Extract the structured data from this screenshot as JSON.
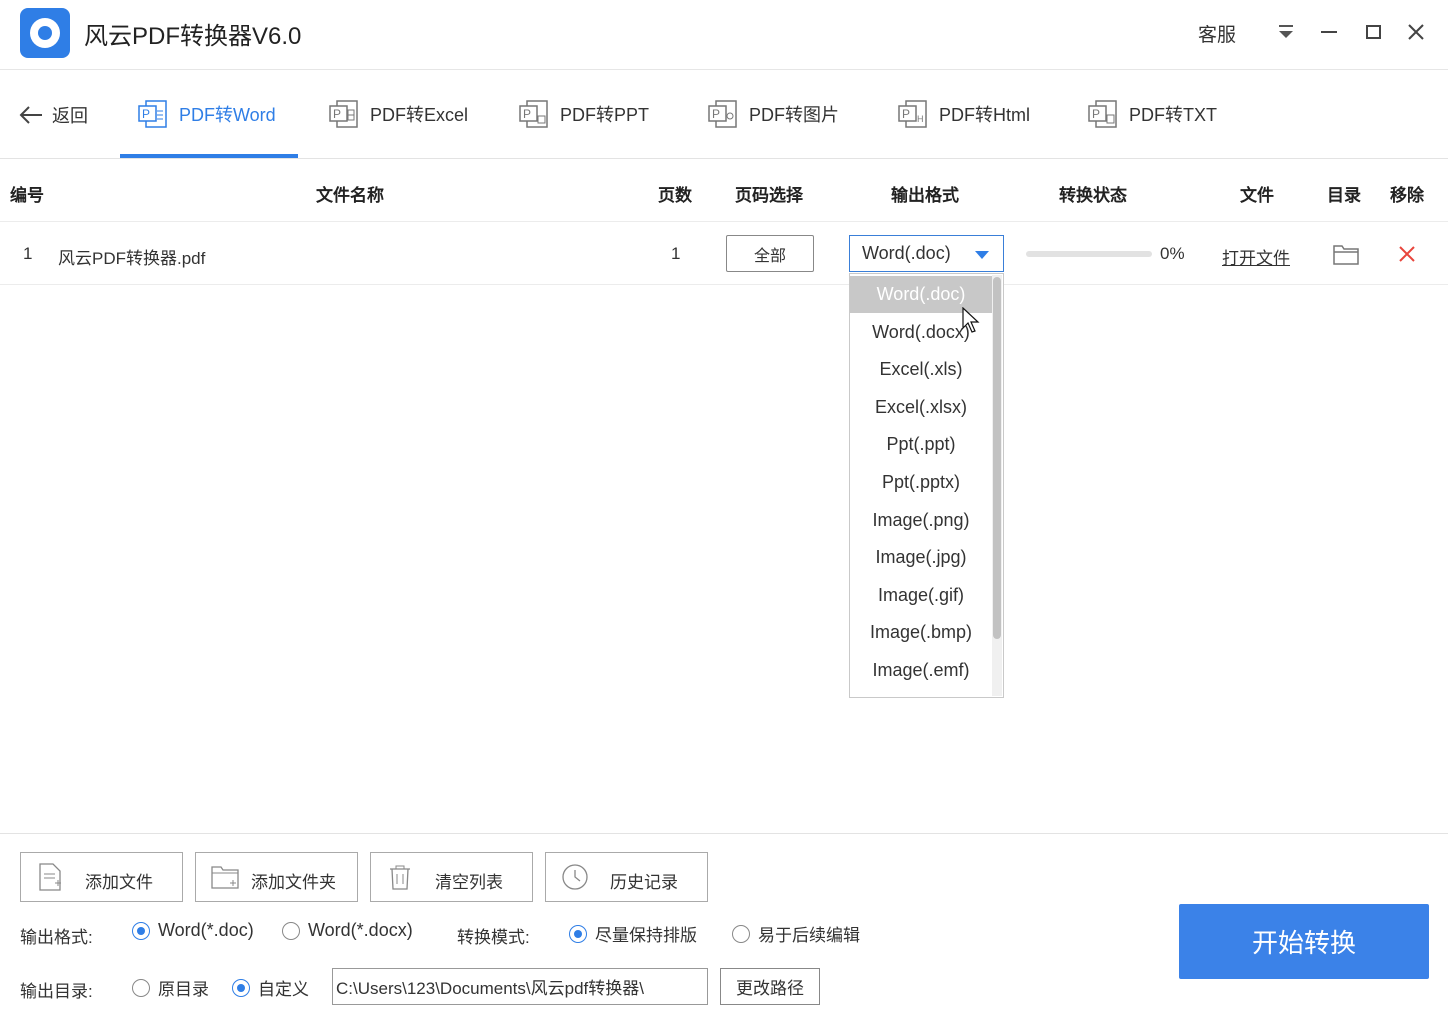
{
  "titlebar": {
    "app_title": "风云PDF转换器V6.0",
    "service_label": "客服"
  },
  "nav": {
    "back_label": "返回",
    "tabs": [
      {
        "label": "PDF转Word",
        "active": true
      },
      {
        "label": "PDF转Excel",
        "active": false
      },
      {
        "label": "PDF转PPT",
        "active": false
      },
      {
        "label": "PDF转图片",
        "active": false
      },
      {
        "label": "PDF转Html",
        "active": false
      },
      {
        "label": "PDF转TXT",
        "active": false
      }
    ]
  },
  "table": {
    "headers": {
      "index": "编号",
      "filename": "文件名称",
      "pages": "页数",
      "page_select": "页码选择",
      "output_format": "输出格式",
      "status": "转换状态",
      "file": "文件",
      "directory": "目录",
      "remove": "移除"
    },
    "rows": [
      {
        "index": "1",
        "filename": "风云PDF转换器.pdf",
        "pages": "1",
        "page_select": "全部",
        "format": "Word(.doc)",
        "progress": 0,
        "progress_text": "0%",
        "open_file": "打开文件"
      }
    ]
  },
  "dropdown": {
    "options": [
      "Word(.doc)",
      "Word(.docx)",
      "Excel(.xls)",
      "Excel(.xlsx)",
      "Ppt(.ppt)",
      "Ppt(.pptx)",
      "Image(.png)",
      "Image(.jpg)",
      "Image(.gif)",
      "Image(.bmp)",
      "Image(.emf)"
    ],
    "selected_index": 0
  },
  "toolbar": {
    "add_file": "添加文件",
    "add_folder": "添加文件夹",
    "clear_list": "清空列表",
    "history": "历史记录"
  },
  "options": {
    "output_format_label": "输出格式:",
    "format_doc": "Word(*.doc)",
    "format_docx": "Word(*.docx)",
    "mode_label": "转换模式:",
    "mode_keep_layout": "尽量保持排版",
    "mode_easy_edit": "易于后续编辑",
    "output_dir_label": "输出目录:",
    "dir_original": "原目录",
    "dir_custom": "自定义",
    "path_value": "C:\\Users\\123\\Documents\\风云pdf转换器\\",
    "change_path": "更改路径"
  },
  "start_button": "开始转换",
  "colors": {
    "accent": "#2f7ee6",
    "start_button": "#3b82e8",
    "remove": "#e8453c"
  }
}
